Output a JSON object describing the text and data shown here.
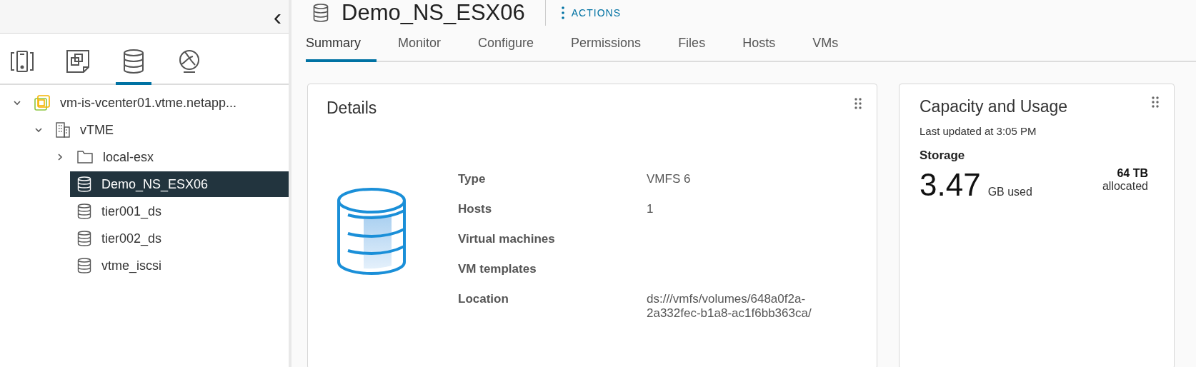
{
  "sidebar": {
    "collapse_label": "‹",
    "view_tabs": [
      {
        "kind": "hosts",
        "selected": false
      },
      {
        "kind": "vms",
        "selected": false
      },
      {
        "kind": "storage",
        "selected": true
      },
      {
        "kind": "network",
        "selected": false
      }
    ],
    "tree": [
      {
        "kind": "vcenter",
        "label": "vm-is-vcenter01.vtme.netapp...",
        "expanded": true,
        "selected": false,
        "children": [
          {
            "kind": "datacenter",
            "label": "vTME",
            "expanded": true,
            "selected": false,
            "children": [
              {
                "kind": "folder",
                "label": "local-esx",
                "expanded": false,
                "selected": false
              },
              {
                "kind": "datastore",
                "label": "Demo_NS_ESX06",
                "selected": true
              },
              {
                "kind": "datastore",
                "label": "tier001_ds",
                "selected": false
              },
              {
                "kind": "datastore",
                "label": "tier002_ds",
                "selected": false
              },
              {
                "kind": "datastore",
                "label": "vtme_iscsi",
                "selected": false
              }
            ]
          }
        ]
      }
    ]
  },
  "header": {
    "title": "Demo_NS_ESX06",
    "actions": "ACTIONS"
  },
  "tabs": [
    {
      "label": "Summary",
      "selected": true
    },
    {
      "label": "Monitor",
      "selected": false
    },
    {
      "label": "Configure",
      "selected": false
    },
    {
      "label": "Permissions",
      "selected": false
    },
    {
      "label": "Files",
      "selected": false
    },
    {
      "label": "Hosts",
      "selected": false
    },
    {
      "label": "VMs",
      "selected": false
    }
  ],
  "details": {
    "title": "Details",
    "rows": [
      {
        "label": "Type",
        "value": "VMFS 6"
      },
      {
        "label": "Hosts",
        "value": "1"
      },
      {
        "label": "Virtual machines"
      },
      {
        "label": "VM templates"
      },
      {
        "label": "Location",
        "value": "ds:///vmfs/volumes/648a0f2a-2a332fec-b1a8-ac1f6bb363ca/"
      }
    ]
  },
  "capacity": {
    "title": "Capacity and Usage",
    "updated": "Last updated at 3:05 PM",
    "section": "Storage",
    "used_value": "3.47",
    "used_unit": "GB used",
    "allocated_value": "64 TB",
    "allocated_label": "allocated"
  }
}
